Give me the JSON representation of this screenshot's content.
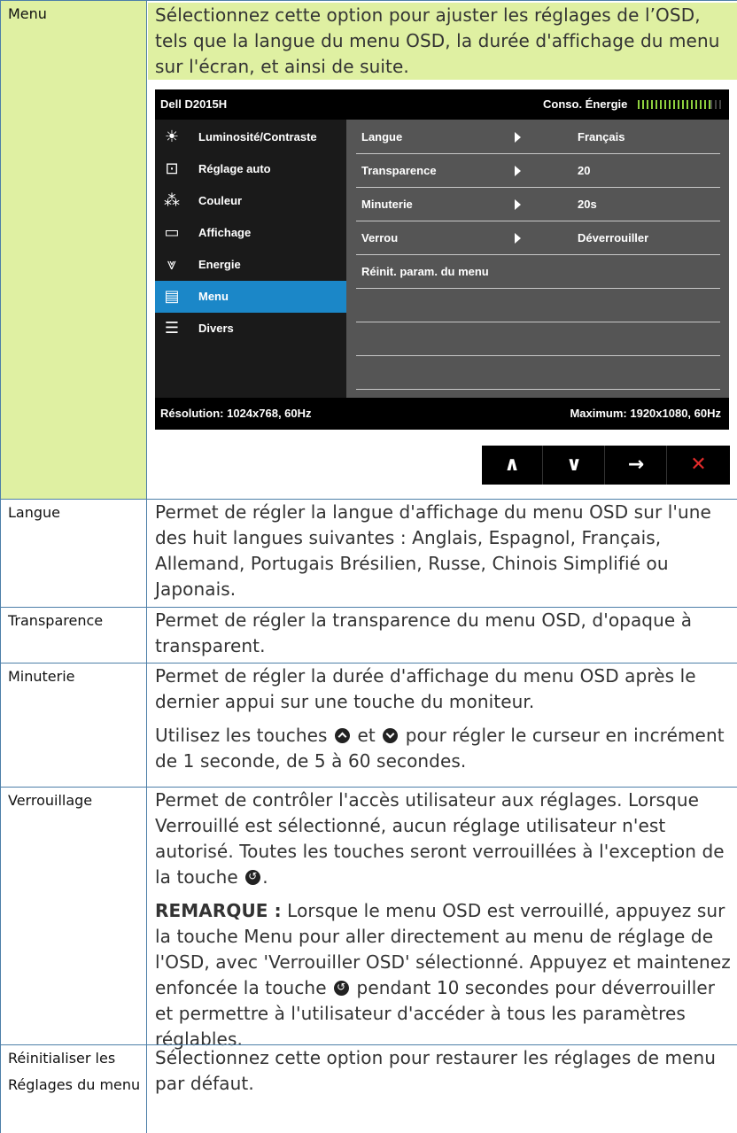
{
  "rows": [
    {
      "label": "Menu",
      "desc": [
        "Sélectionnez cette option pour ajuster les réglages de l’OSD, tels que la langue du menu OSD, la durée d'affichage du menu sur l'écran, et ainsi de suite."
      ]
    },
    {
      "label": "Langue",
      "desc": [
        "Permet de régler la langue d'affichage du menu OSD sur l'une des huit langues suivantes : Anglais, Espagnol, Français, Allemand, Portugais Brésilien, Russe, Chinois Simplifié ou Japonais."
      ]
    },
    {
      "label": "Transparence",
      "desc": [
        "Permet de régler la transparence du menu OSD, d'opaque à transparent."
      ]
    },
    {
      "label": "Minuterie",
      "desc": [
        "Permet de régler la durée d'affichage du menu OSD après le dernier appui sur une touche du moniteur.",
        {
          "before": "Utilisez les touches ",
          "mid": " et ",
          "after": " pour régler le curseur en incrément de 1 seconde, de 5 à 60 secondes."
        }
      ]
    },
    {
      "label": "Verrouillage",
      "desc": [
        {
          "before": "Permet de contrôler l'accès utilisateur aux réglages. Lorsque Verrouillé est sélectionné, aucun réglage utilisateur n'est autorisé. Toutes les touches seront verrouillées à l'exception de la touche ",
          "after": "."
        },
        {
          "note": "REMARQUE :",
          "before": " Lorsque le menu OSD est verrouillé, appuyez sur la touche Menu pour aller directement au menu de réglage de l'OSD, avec 'Verrouiller OSD' sélectionné. Appuyez et maintenez enfoncée la touche ",
          "after": " pendant 10 secondes pour déverrouiller et permettre à l'utilisateur d'accéder à tous les paramètres réglables."
        }
      ]
    },
    {
      "label": "Réinitialiser les Réglages du menu",
      "desc": [
        "Sélectionnez cette option pour restaurer les réglages de menu par défaut."
      ]
    }
  ],
  "osd": {
    "model": "Dell D2015H",
    "energy_label": "Conso. Énergie",
    "energy_level": 0.86,
    "side_items": [
      {
        "label": "Luminosité/Contraste",
        "icon": "brightness-icon",
        "glyph": "☀"
      },
      {
        "label": "Réglage auto",
        "icon": "auto-adjust-icon",
        "glyph": "⊡"
      },
      {
        "label": "Couleur",
        "icon": "color-icon",
        "glyph": "⁂"
      },
      {
        "label": "Affichage",
        "icon": "display-icon",
        "glyph": "▭"
      },
      {
        "label": "Energie",
        "icon": "energy-icon",
        "glyph": "⩔"
      },
      {
        "label": "Menu",
        "icon": "menu-icon",
        "glyph": "▤",
        "active": true
      },
      {
        "label": "Divers",
        "icon": "others-icon",
        "glyph": "☰"
      }
    ],
    "options": [
      {
        "name": "Langue",
        "value": "Français",
        "arrow": true
      },
      {
        "name": "Transparence",
        "value": "20",
        "arrow": true
      },
      {
        "name": "Minuterie",
        "value": "20s",
        "arrow": true
      },
      {
        "name": "Verrou",
        "value": "Déverrouiller",
        "arrow": true
      },
      {
        "name": "Réinit. param. du menu",
        "value": "",
        "arrow": false
      },
      {
        "name": "",
        "value": "",
        "arrow": false
      },
      {
        "name": "",
        "value": "",
        "arrow": false
      },
      {
        "name": "",
        "value": "",
        "arrow": false
      }
    ],
    "resolution": "Résolution: 1024x768, 60Hz",
    "maximum": "Maximum: 1920x1080, 60Hz"
  },
  "buttons": [
    {
      "name": "up-button",
      "icon": "chevron-up-icon",
      "glyph": "∧"
    },
    {
      "name": "down-button",
      "icon": "chevron-down-icon",
      "glyph": "∨"
    },
    {
      "name": "enter-button",
      "icon": "arrow-right-icon",
      "glyph": "→"
    },
    {
      "name": "exit-button",
      "icon": "close-icon",
      "glyph": "✕"
    }
  ]
}
